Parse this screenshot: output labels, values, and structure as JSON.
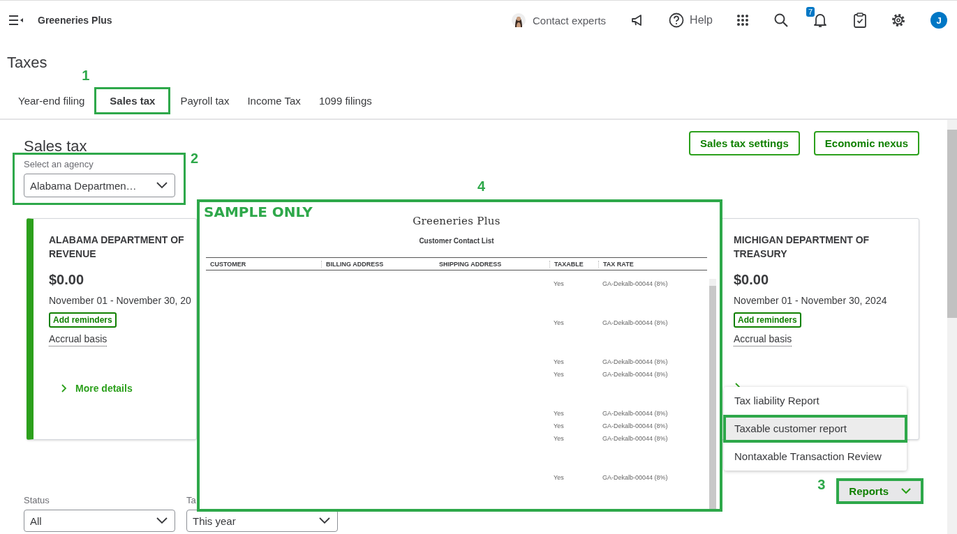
{
  "app": {
    "company": "Greeneries Plus"
  },
  "header": {
    "contact": "Contact experts",
    "help": "Help",
    "notifications_badge": "7",
    "avatar": "J"
  },
  "page_title": "Taxes",
  "tabs": [
    {
      "label": "Year-end filing",
      "selected": false,
      "highlighted": false
    },
    {
      "label": "Sales tax",
      "selected": true,
      "highlighted": true,
      "callout": "1"
    },
    {
      "label": "Payroll tax",
      "selected": false,
      "highlighted": false
    },
    {
      "label": "Income Tax",
      "selected": false,
      "highlighted": false
    },
    {
      "label": "1099 filings",
      "selected": false,
      "highlighted": false
    }
  ],
  "section": {
    "title": "Sales tax",
    "buttons": [
      "Sales tax settings",
      "Economic nexus"
    ]
  },
  "agency": {
    "label": "Select an agency",
    "value": "Alabama Departmen…",
    "highlighted": true,
    "callout": "2"
  },
  "cards": [
    {
      "title": "ALABAMA DEPARTMENT OF REVENUE",
      "amount": "$0.00",
      "period": "November 01 - November 30, 20",
      "reminder": "Add reminders",
      "basis": "Accrual basis",
      "link": "More details",
      "selected": true
    },
    {
      "title": "MICHIGAN DEPARTMENT OF TREASURY",
      "amount": "$0.00",
      "period": "November 01 - November 30, 2024",
      "reminder": "Add reminders",
      "basis": "Accrual basis",
      "selected": false
    }
  ],
  "reports_menu": {
    "items": [
      {
        "label": "Tax liability Report",
        "selected": false,
        "highlighted": false
      },
      {
        "label": "Taxable customer report",
        "selected": true,
        "highlighted": true
      },
      {
        "label": "Nontaxable Transaction Review",
        "selected": false,
        "highlighted": false
      }
    ]
  },
  "reports_button": {
    "label": "Reports",
    "highlighted": true,
    "callout": "3"
  },
  "filters": [
    {
      "label": "Status",
      "value": "All"
    },
    {
      "label": "Ta",
      "value": "This year"
    }
  ],
  "sample_report": {
    "stamp": "SAMPLE ONLY",
    "callout": "4",
    "company": "Greeneries Plus",
    "title": "Customer Contact List",
    "columns": [
      "CUSTOMER",
      "BILLING ADDRESS",
      "SHIPPING ADDRESS",
      "TAXABLE",
      "TAX RATE"
    ],
    "row_groups": [
      {
        "rows": [
          {
            "taxable": "Yes",
            "tax_rate": "GA-Dekalb-00044 (8%)"
          }
        ]
      },
      {
        "rows": [
          {
            "taxable": "Yes",
            "tax_rate": "GA-Dekalb-00044 (8%)"
          }
        ]
      },
      {
        "rows": [
          {
            "taxable": "Yes",
            "tax_rate": "GA-Dekalb-00044 (8%)"
          },
          {
            "taxable": "Yes",
            "tax_rate": "GA-Dekalb-00044 (8%)"
          }
        ]
      },
      {
        "rows": [
          {
            "taxable": "Yes",
            "tax_rate": "GA-Dekalb-00044 (8%)"
          },
          {
            "taxable": "Yes",
            "tax_rate": "GA-Dekalb-00044 (8%)"
          },
          {
            "taxable": "Yes",
            "tax_rate": "GA-Dekalb-00044 (8%)"
          }
        ]
      },
      {
        "rows": [
          {
            "taxable": "Yes",
            "tax_rate": "GA-Dekalb-00044 (8%)"
          }
        ]
      }
    ]
  }
}
